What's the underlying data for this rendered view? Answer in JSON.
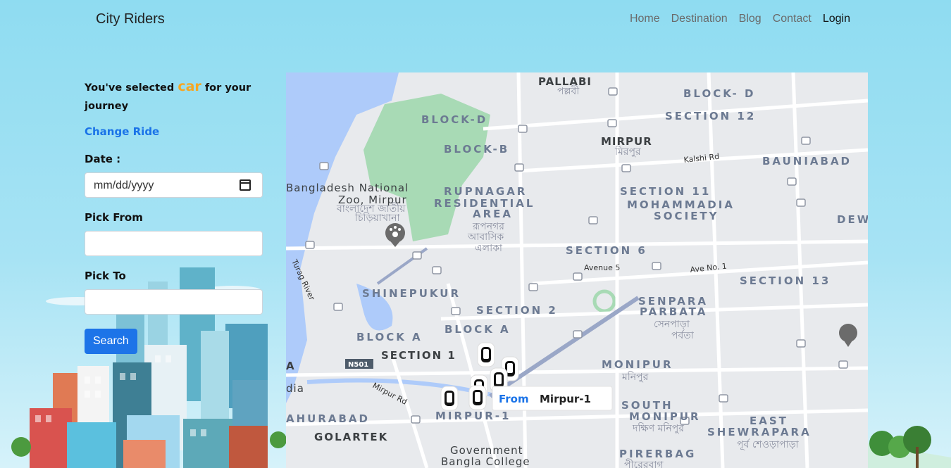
{
  "navbar": {
    "brand": "City Riders",
    "links": [
      "Home",
      "Destination",
      "Blog",
      "Contact"
    ],
    "login": "Login"
  },
  "panel": {
    "selected_prefix": "You've selected",
    "selected_vehicle": "car",
    "selected_suffix": "for your journey",
    "change_ride": "Change Ride",
    "date_label": "Date :",
    "date_placeholder": "mm/dd/yyyy",
    "pick_from_label": "Pick From",
    "pick_from_value": "",
    "pick_to_label": "Pick To",
    "pick_to_value": "",
    "search_label": "Search"
  },
  "map": {
    "areas": {
      "pallabi": "PALLABI",
      "pallabi_bn": "পল্লবী",
      "block_d_top": "BLOCK- D",
      "section_12": "SECTION 12",
      "block_d": "BLOCK-D",
      "mirpur": "MIRPUR",
      "mirpur_bn": "মিরপুর",
      "block_b": "BLOCK-B",
      "bauniabad": "BAUNIABAD",
      "zoo_1": "Bangladesh National",
      "zoo_2": "Zoo, Mirpur",
      "zoo_bn_1": "বাংলাদেশ জাতীয়",
      "zoo_bn_2": "চিড়িয়াখানা",
      "rupnagar_1": "RUPNAGAR",
      "rupnagar_2": "RESIDENTIAL",
      "rupnagar_3": "AREA",
      "rupnagar_bn_1": "রূপনগর",
      "rupnagar_bn_2": "আবাসিক",
      "rupnagar_bn_3": "এলাকা",
      "section_11": "SECTION 11",
      "mohammadia_1": "MOHAMMADIA",
      "mohammadia_2": "SOCIETY",
      "dew": "DEW",
      "section_6": "SECTION 6",
      "shinepukur": "SHINEPUKUR",
      "section_13": "SECTION 13",
      "section_2": "SECTION 2",
      "senpara_1": "SENPARA",
      "senpara_2": "PARBATA",
      "senpara_bn_1": "সেনপাড়া",
      "senpara_bn_2": "পর্বতা",
      "block_a_1": "BLOCK A",
      "block_a_2": "BLOCK A",
      "section_1": "SECTION 1",
      "monipur": "MONIPUR",
      "monipur_bn": "মনিপুর",
      "a": "A",
      "dia": "dia",
      "south_monipur_1": "SOUTH",
      "south_monipur_2": "MONIPUR",
      "south_monipur_bn": "দক্ষিণ মনিপুর",
      "east_1": "EAST",
      "east_2": "SHEWRAPARA",
      "east_bn": "পূর্ব শেওড়াপাড়া",
      "ahurabad": "AHURABAD",
      "mirpur_1": "MIRPUR-1",
      "golartek": "GOLARTEK",
      "govt_1": "Government",
      "govt_2": "Bangla College",
      "pirerbag": "PIRERBAG",
      "pirerbag_bn": "পীরেরবাগ"
    },
    "roads": {
      "kalshi": "Kalshi Rd",
      "avenue5": "Avenue 5",
      "ave1": "Ave No. 1",
      "turag": "Turag River",
      "mirpur_rd": "Mirpur Rd",
      "n501": "N501"
    },
    "tooltip_from": "From",
    "tooltip_place": "Mirpur-1",
    "colors": {
      "water": "#aecbfa",
      "park": "#a8dab5",
      "road": "#ffffff",
      "major_road": "#9aa7c7",
      "accent": "#1a73e8"
    }
  }
}
